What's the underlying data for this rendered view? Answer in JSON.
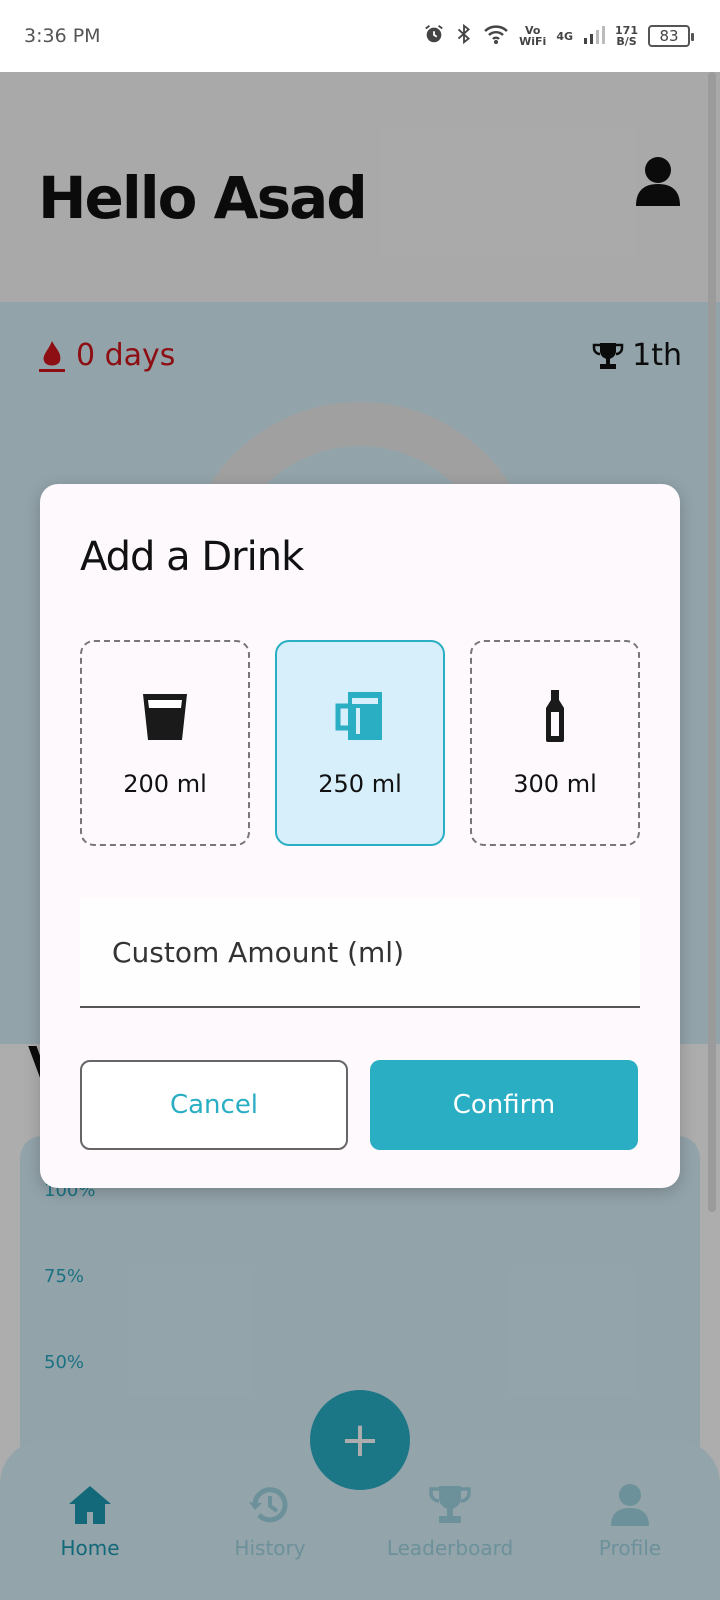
{
  "status_bar": {
    "time": "3:36 PM",
    "network_vo": "Vo",
    "network_wifi": "WiFi",
    "network_4g": "4G",
    "speed_value": "171",
    "speed_unit": "B/S",
    "battery": "83"
  },
  "header": {
    "greeting": "Hello Asad",
    "profile_icon": "user-icon"
  },
  "stats": {
    "streak": "0 days",
    "streak_icon": "flame-icon",
    "rank": "1th",
    "rank_icon": "trophy-icon"
  },
  "section_partial_letter": "V",
  "chart": {
    "ticks": [
      "100%",
      "75%",
      "50%"
    ]
  },
  "fab": {
    "label": "+"
  },
  "nav": {
    "items": [
      {
        "label": "Home",
        "icon": "home-icon",
        "active": true
      },
      {
        "label": "History",
        "icon": "history-icon",
        "active": false
      },
      {
        "label": "Leaderboard",
        "icon": "trophy-icon",
        "active": false
      },
      {
        "label": "Profile",
        "icon": "user-icon",
        "active": false
      }
    ]
  },
  "dialog": {
    "title": "Add a Drink",
    "options": [
      {
        "amount": "200 ml",
        "icon": "glass-icon",
        "selected": false
      },
      {
        "amount": "250 ml",
        "icon": "mug-icon",
        "selected": true
      },
      {
        "amount": "300 ml",
        "icon": "bottle-icon",
        "selected": false
      }
    ],
    "custom_placeholder": "Custom Amount (ml)",
    "cancel_label": "Cancel",
    "confirm_label": "Confirm"
  },
  "colors": {
    "accent": "#2aaec4",
    "selected_bg": "#d6effa",
    "streak_red": "#d0151c",
    "hero_bg": "#d8f1fb"
  }
}
